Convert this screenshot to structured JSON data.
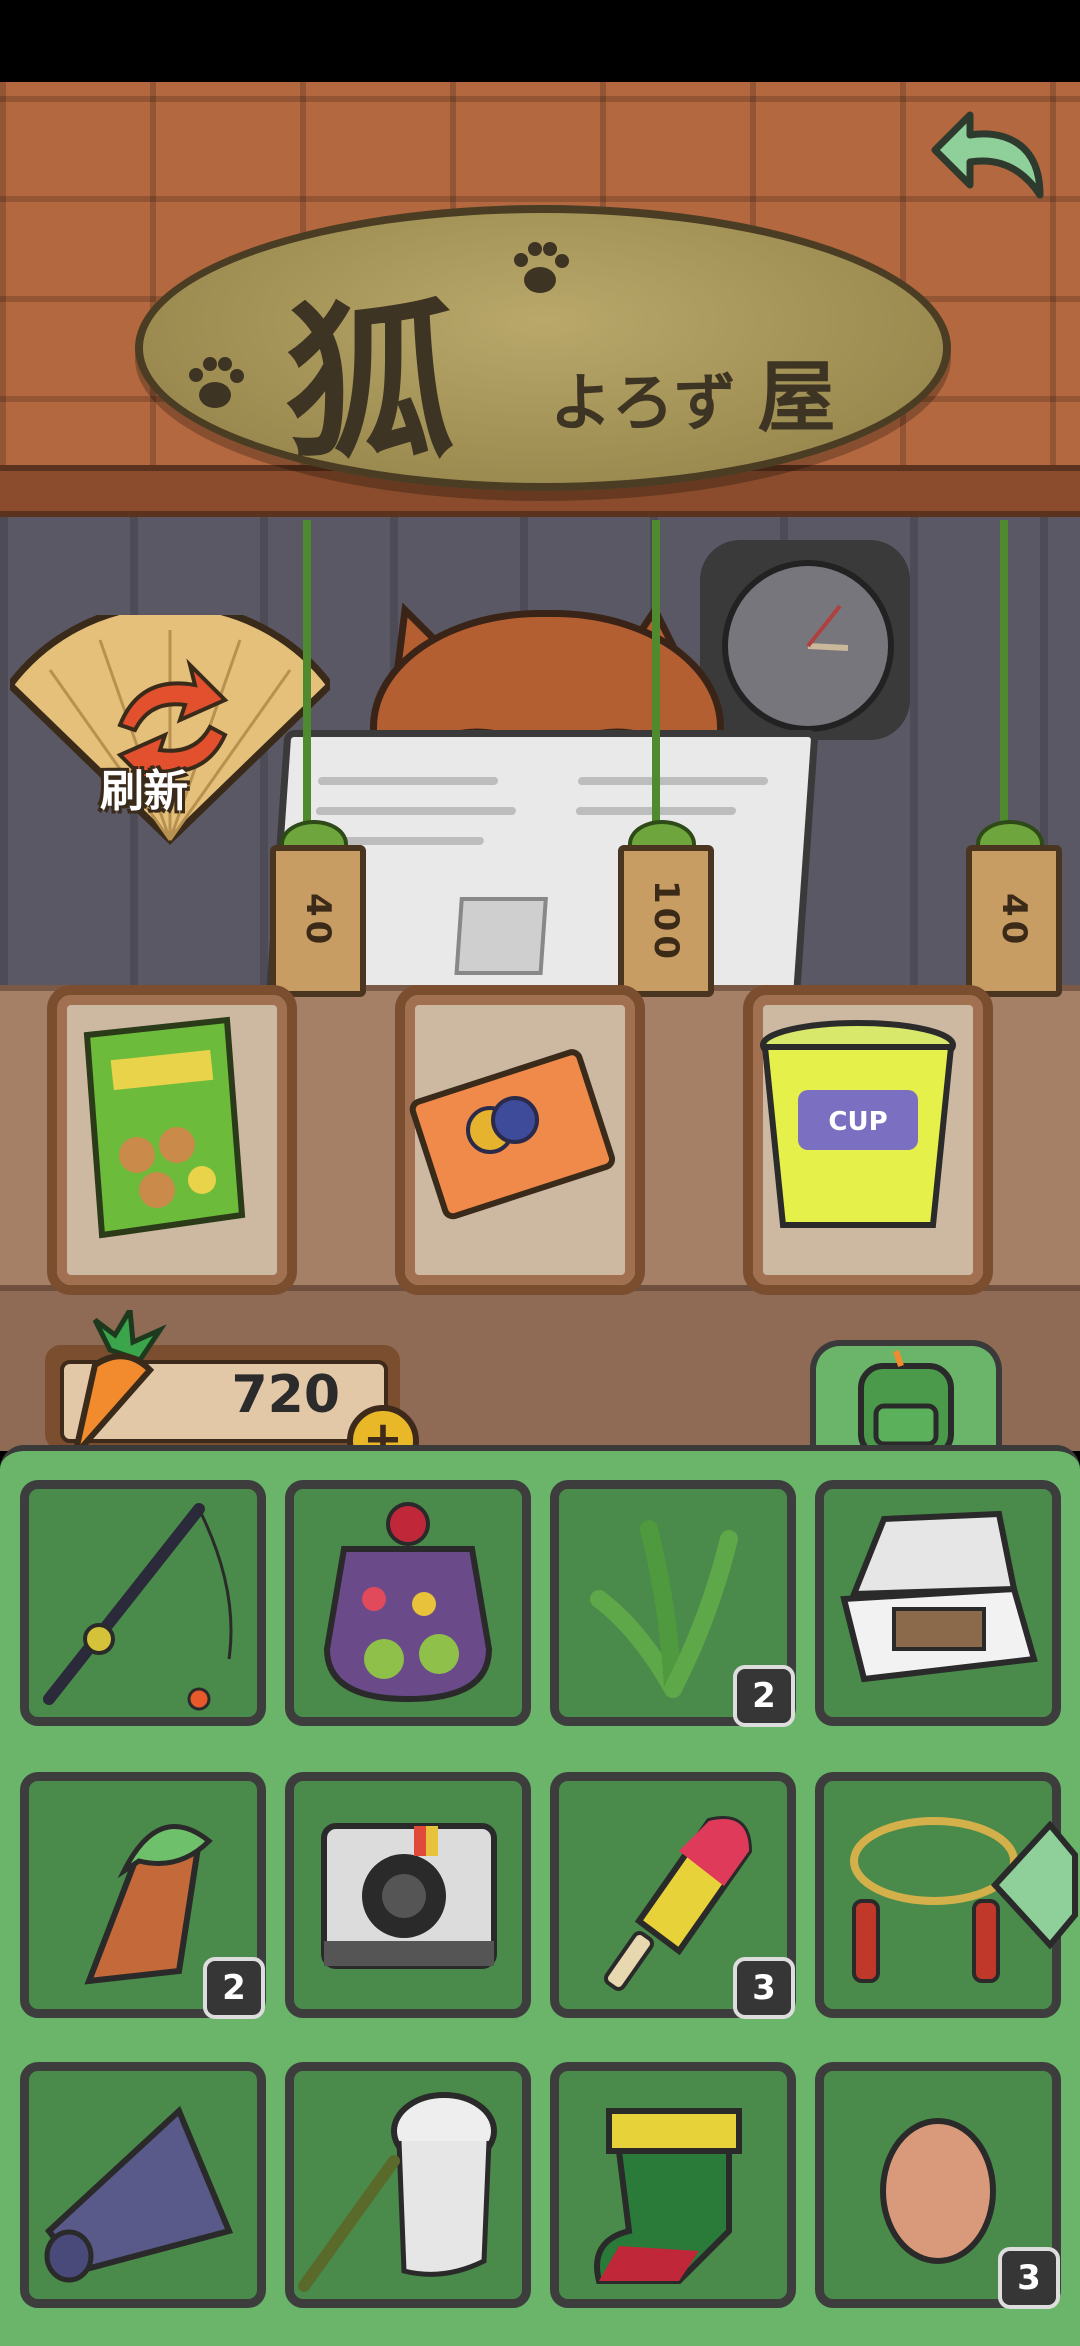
{
  "sign": {
    "kanji": "狐",
    "kana": "よろず",
    "kanji2": "屋"
  },
  "refresh": {
    "label": "刷新"
  },
  "shop_items": [
    {
      "name": "nin-jin-snack",
      "price": "40"
    },
    {
      "name": "collection-ticket",
      "price": "100"
    },
    {
      "name": "cup-noodles",
      "price": "40"
    }
  ],
  "currency": {
    "icon": "carrot-icon",
    "amount": "720"
  },
  "inventory": [
    {
      "name": "fishing-rod",
      "count": ""
    },
    {
      "name": "fruit-jelly-jar",
      "count": ""
    },
    {
      "name": "seaweed",
      "count": "2"
    },
    {
      "name": "sandwich-box",
      "count": ""
    },
    {
      "name": "taiyaki-ice-cream",
      "count": "2"
    },
    {
      "name": "instant-camera",
      "count": ""
    },
    {
      "name": "popsicle",
      "count": "3"
    },
    {
      "name": "jump-rope",
      "count": ""
    },
    {
      "name": "rolled-mat",
      "count": ""
    },
    {
      "name": "bug-net",
      "count": ""
    },
    {
      "name": "christmas-stocking",
      "count": ""
    },
    {
      "name": "egg",
      "count": "3"
    }
  ]
}
